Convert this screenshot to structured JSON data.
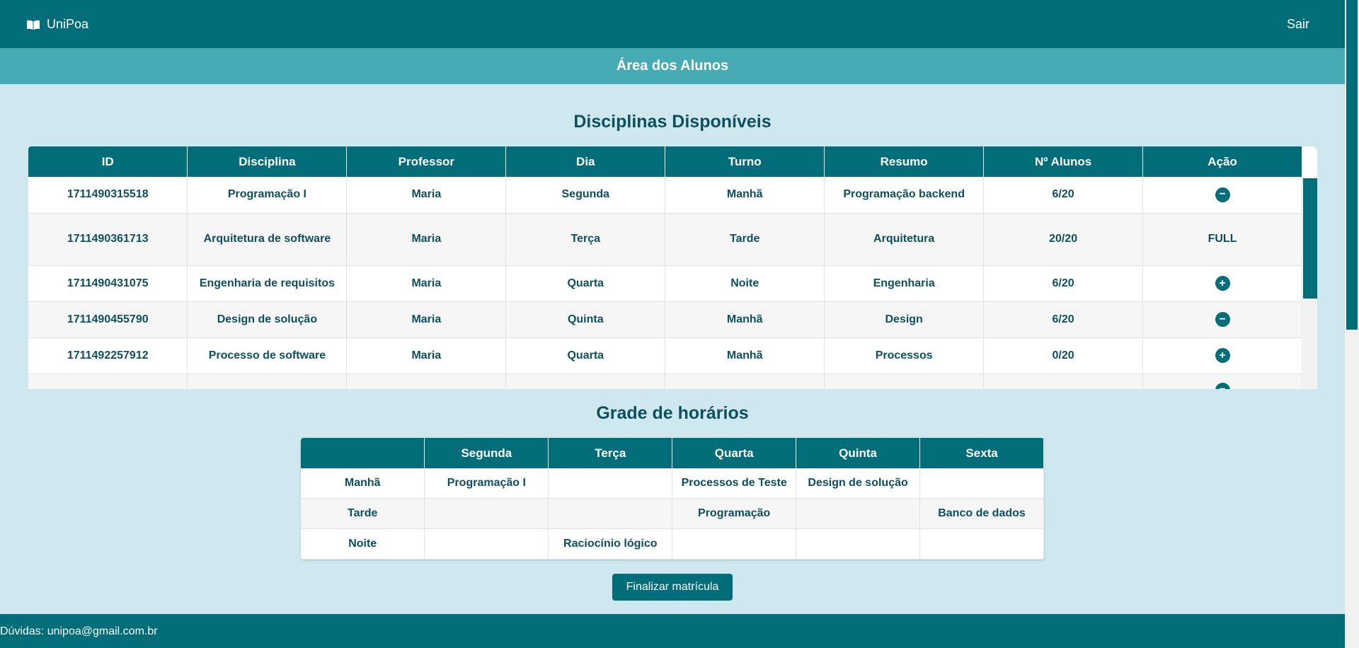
{
  "navbar": {
    "brand": "UniPoa",
    "logout": "Sair"
  },
  "subheader": "Área dos Alunos",
  "disciplinas": {
    "title": "Disciplinas Disponíveis",
    "columns": [
      "ID",
      "Disciplina",
      "Professor",
      "Dia",
      "Turno",
      "Resumo",
      "Nº Alunos",
      "Ação"
    ],
    "rows": [
      {
        "id": "1711490315518",
        "disciplina": "Programação I",
        "professor": "Maria",
        "dia": "Segunda",
        "turno": "Manhã",
        "resumo": "Programação backend",
        "alunos": "6/20",
        "acao": "remove",
        "acao_text": ""
      },
      {
        "id": "1711490361713",
        "disciplina": "Arquitetura de software",
        "professor": "Maria",
        "dia": "Terça",
        "turno": "Tarde",
        "resumo": "Arquitetura",
        "alunos": "20/20",
        "acao": "full",
        "acao_text": "FULL"
      },
      {
        "id": "1711490431075",
        "disciplina": "Engenharia de requisitos",
        "professor": "Maria",
        "dia": "Quarta",
        "turno": "Noite",
        "resumo": "Engenharia",
        "alunos": "6/20",
        "acao": "add",
        "acao_text": ""
      },
      {
        "id": "1711490455790",
        "disciplina": "Design de solução",
        "professor": "Maria",
        "dia": "Quinta",
        "turno": "Manhã",
        "resumo": "Design",
        "alunos": "6/20",
        "acao": "remove",
        "acao_text": ""
      },
      {
        "id": "1711492257912",
        "disciplina": "Processo de software",
        "professor": "Maria",
        "dia": "Quarta",
        "turno": "Manhã",
        "resumo": "Processos",
        "alunos": "0/20",
        "acao": "add",
        "acao_text": ""
      }
    ]
  },
  "grade": {
    "title": "Grade de horários",
    "columns": [
      "",
      "Segunda",
      "Terça",
      "Quarta",
      "Quinta",
      "Sexta"
    ],
    "rows": [
      [
        "Manhã",
        "Programação I",
        "",
        "Processos de Teste",
        "Design de solução",
        ""
      ],
      [
        "Tarde",
        "",
        "",
        "Programação",
        "",
        "Banco de dados"
      ],
      [
        "Noite",
        "",
        "Raciocínio lógico",
        "",
        "",
        ""
      ]
    ]
  },
  "finish_button": "Finalizar matrícula",
  "footer": "Dúvidas: unipoa@gmail.com.br",
  "icons": {
    "brand": "book-icon",
    "remove": "minus-circle-icon",
    "add": "plus-circle-icon"
  },
  "colors": {
    "primary": "#016d78",
    "secondary": "#47abb6",
    "background": "#cfe8ef"
  }
}
